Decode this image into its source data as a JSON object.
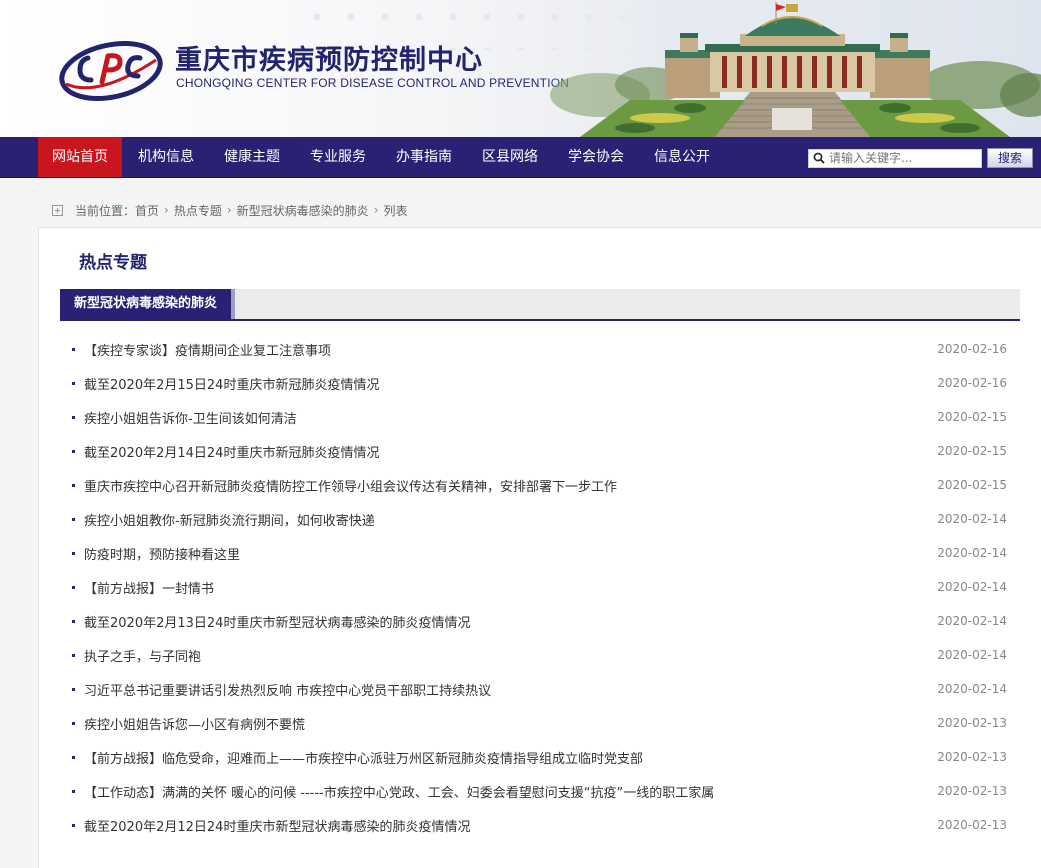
{
  "header": {
    "title": "重庆市疾病预防控制中心",
    "subtitle": "CHONGQING CENTER FOR DISEASE CONTROL AND PREVENTION",
    "brand_color": "#2b2174"
  },
  "nav": {
    "items": [
      {
        "label": "网站首页",
        "active": true
      },
      {
        "label": "机构信息"
      },
      {
        "label": "健康主题"
      },
      {
        "label": "专业服务"
      },
      {
        "label": "办事指南"
      },
      {
        "label": "区县网络"
      },
      {
        "label": "学会协会"
      },
      {
        "label": "信息公开"
      }
    ],
    "active_color": "#c9151e",
    "search": {
      "placeholder": "请输入关键字...",
      "button_label": "搜索",
      "icon": "search-icon"
    }
  },
  "breadcrumb": {
    "label": "当前位置：",
    "items": [
      "首页",
      "热点专题",
      "新型冠状病毒感染的肺炎",
      "列表"
    ]
  },
  "main": {
    "section_title": "热点专题",
    "subject_tab": "新型冠状病毒感染的肺炎",
    "news": [
      {
        "title": "【疾控专家谈】疫情期间企业复工注意事项",
        "date": "2020-02-16"
      },
      {
        "title": "截至2020年2月15日24时重庆市新冠肺炎疫情情况",
        "date": "2020-02-16"
      },
      {
        "title": "疾控小姐姐告诉你-卫生间该如何清洁",
        "date": "2020-02-15"
      },
      {
        "title": "截至2020年2月14日24时重庆市新冠肺炎疫情情况",
        "date": "2020-02-15"
      },
      {
        "title": "重庆市疾控中心召开新冠肺炎疫情防控工作领导小组会议传达有关精神，安排部署下一步工作",
        "date": "2020-02-15"
      },
      {
        "title": "疾控小姐姐教你-新冠肺炎流行期间，如何收寄快递",
        "date": "2020-02-14"
      },
      {
        "title": "防疫时期，预防接种看这里",
        "date": "2020-02-14"
      },
      {
        "title": "【前方战报】一封情书",
        "date": "2020-02-14"
      },
      {
        "title": "截至2020年2月13日24时重庆市新型冠状病毒感染的肺炎疫情情况",
        "date": "2020-02-14"
      },
      {
        "title": "执子之手，与子同袍",
        "date": "2020-02-14"
      },
      {
        "title": "习近平总书记重要讲话引发热烈反响 市疾控中心党员干部职工持续热议",
        "date": "2020-02-14"
      },
      {
        "title": "疾控小姐姐告诉您—小区有病例不要慌",
        "date": "2020-02-13"
      },
      {
        "title": "【前方战报】临危受命，迎难而上——市疾控中心派驻万州区新冠肺炎疫情指导组成立临时党支部",
        "date": "2020-02-13"
      },
      {
        "title": "【工作动态】满满的关怀 暖心的问候 -----市疾控中心党政、工会、妇委会看望慰问支援“抗疫”一线的职工家属",
        "date": "2020-02-13"
      },
      {
        "title": "截至2020年2月12日24时重庆市新型冠状病毒感染的肺炎疫情情况",
        "date": "2020-02-13"
      }
    ]
  }
}
